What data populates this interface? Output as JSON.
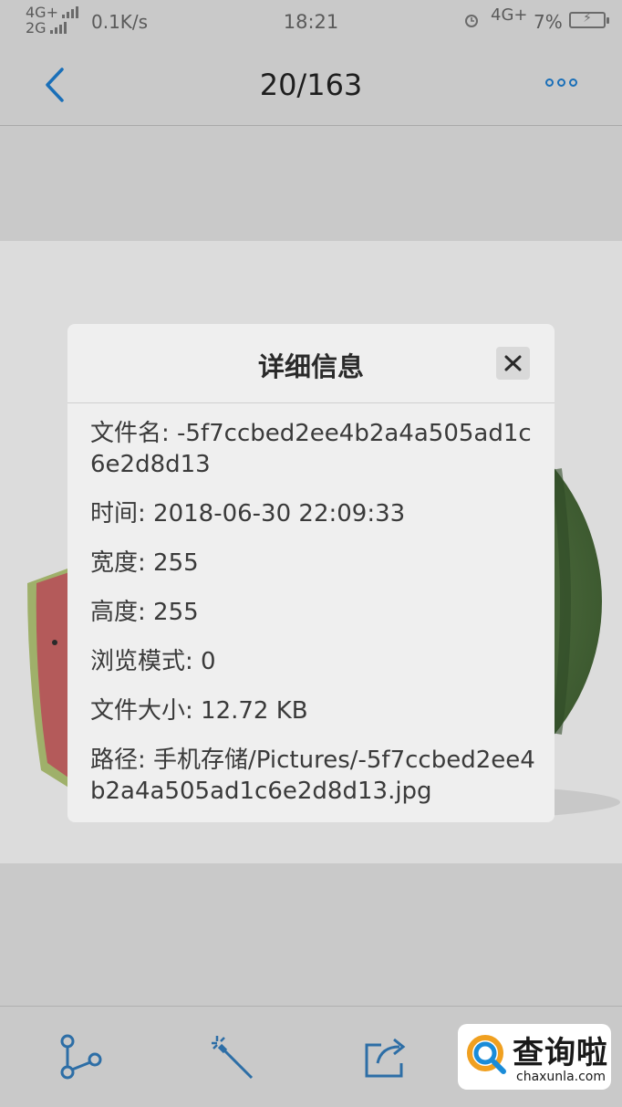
{
  "status_bar": {
    "network_top": "4G+",
    "network_bottom": "2G",
    "speed": "0.1K/s",
    "time": "18:21",
    "network_right": "4G+",
    "battery_percent": "7%",
    "icons": [
      "signal-icon",
      "alarm-icon",
      "battery-charging-icon"
    ]
  },
  "header": {
    "counter": "20/163",
    "icons": [
      "back-chevron-icon",
      "more-icon"
    ],
    "accent": "#1a6fb8"
  },
  "dialog": {
    "title": "详细信息",
    "close_icon": "close-icon",
    "items": [
      {
        "label": "文件名: ",
        "value": "-5f7ccbed2ee4b2a4a505ad1c6e2d8d13"
      },
      {
        "label": "时间: ",
        "value": "2018-06-30 22:09:33"
      },
      {
        "label": "宽度: ",
        "value": "255"
      },
      {
        "label": "高度: ",
        "value": "255"
      },
      {
        "label": "浏览模式: ",
        "value": "0"
      },
      {
        "label": "文件大小: ",
        "value": "12.72 KB"
      },
      {
        "label": "路径: ",
        "value": "手机存储/Pictures/-5f7ccbed2ee4b2a4a505ad1c6e2d8d13.jpg"
      }
    ]
  },
  "toolbar": {
    "icons": [
      "share-branch-icon",
      "magic-wand-icon",
      "export-icon"
    ]
  },
  "watermark": {
    "text_cn": "查询啦",
    "text_en": "chaxunla.com"
  }
}
